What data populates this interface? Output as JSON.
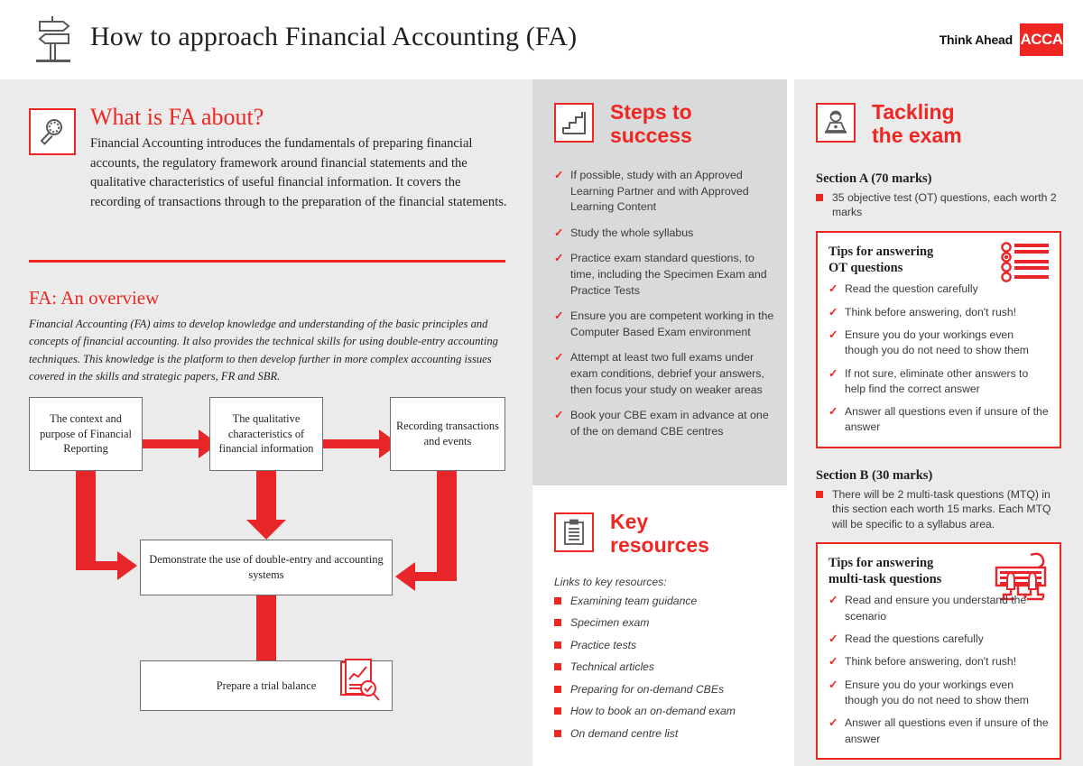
{
  "header": {
    "title": "How to approach Financial Accounting (FA)",
    "signpost_icon": "signpost-icon",
    "tagline": "Think Ahead",
    "logo": "ACCA"
  },
  "colors": {
    "brand_red": "#ee2722",
    "text_dark": "#231f20",
    "panel_light": "#ebebeb",
    "panel_mid": "#d9dadb",
    "box_border": "#6d6e70"
  },
  "about": {
    "icon": "magnifier-icon",
    "heading": "What is FA about?",
    "body": "Financial Accounting introduces the fundamentals of preparing financial accounts, the regulatory framework around financial statements and the qualitative characteristics of useful financial information. It covers the recording of transactions through to the preparation of the financial statements."
  },
  "overview": {
    "heading": "FA: An overview",
    "body": "Financial Accounting (FA) aims to develop knowledge and understanding of the basic principles and concepts of financial accounting. It also provides the technical skills for using double-entry accounting techniques. This knowledge is the platform to then develop further in more complex accounting issues covered in the skills and strategic papers, FR and SBR."
  },
  "flowchart": {
    "boxes": [
      "The context and purpose of Financial Reporting",
      "The qualitative characteristics of financial information",
      "Recording transactions and events",
      "Demonstrate the use of double-entry and accounting systems",
      "Prepare a trial balance"
    ],
    "trial_icon": "report-magnifier-icon"
  },
  "steps": {
    "icon": "stairs-icon",
    "heading_line1": "Steps to",
    "heading_line2": "success",
    "items": [
      "If possible, study with an Approved Learning Partner and with Approved Learning Content",
      "Study the whole syllabus",
      "Practice exam standard questions, to time, including the Specimen Exam and Practice Tests",
      "Ensure you are competent working in the Computer Based Exam environment",
      "Attempt at least two full exams under exam conditions, debrief your answers, then focus your study on weaker areas",
      "Book your CBE exam in advance at one of the on demand CBE centres"
    ]
  },
  "resources": {
    "icon": "clipboard-icon",
    "heading_line1": "Key",
    "heading_line2": "resources",
    "intro": "Links to key resources:",
    "links": [
      "Examining team guidance",
      "Specimen exam",
      "Practice tests",
      "Technical articles",
      "Preparing for on-demand CBEs",
      "How to book an on-demand exam",
      "On demand centre list"
    ]
  },
  "exam": {
    "icon": "person-laptop-icon",
    "heading_line1": "Tackling",
    "heading_line2": "the exam",
    "section_a": {
      "title": "Section A (70 marks)",
      "bullets": [
        "35 objective test (OT) questions, each worth  2 marks"
      ],
      "tips": {
        "title_line1": "Tips for answering",
        "title_line2": "OT questions",
        "icon": "multiple-choice-icon",
        "items": [
          "Read the question carefully",
          "Think before answering, don't rush!",
          "Ensure you do your workings even though you do not need to show them",
          "If not sure, eliminate other answers to help find the correct answer",
          "Answer all questions even if unsure of the answer"
        ]
      }
    },
    "section_b": {
      "title": "Section B (30 marks)",
      "bullets": [
        "There will be 2 multi-task questions (MTQ) in this section each worth 15 marks. Each MTQ will be specific to a syllabus area."
      ],
      "tips": {
        "title_line1": "Tips for answering",
        "title_line2": "multi-task questions",
        "icon": "keyboard-hands-icon",
        "items": [
          "Read and ensure you understand the scenario",
          "Read the questions carefully",
          "Think before answering, don't rush!",
          "Ensure you do your workings even though you do not need to show them",
          "Answer all questions even if unsure of the answer"
        ]
      }
    }
  }
}
